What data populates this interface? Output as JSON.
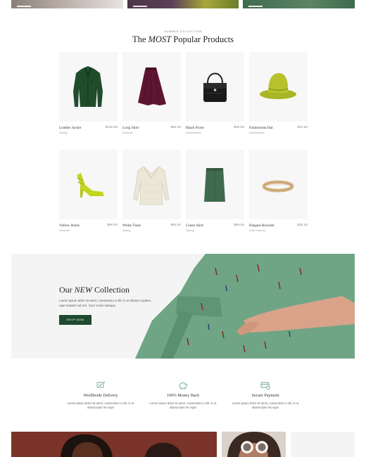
{
  "section": {
    "eyebrow": "Summer Collection",
    "title_prefix": "The ",
    "title_emphasis": "MOST",
    "title_suffix": " Popular Products"
  },
  "products": [
    {
      "name": "Leather Jacket",
      "price": "$150.00",
      "category": "Spring",
      "icon": "leather-jacket"
    },
    {
      "name": "Long Skirt",
      "price": "$80.00",
      "category": "Summer",
      "icon": "long-skirt"
    },
    {
      "name": "Black Purse",
      "price": "$90.00",
      "category": "Accessories",
      "icon": "black-purse"
    },
    {
      "name": "Fashionista Hat",
      "price": "$40.00",
      "category": "Accessories",
      "icon": "green-hat"
    },
    {
      "name": "Yellow Heels",
      "price": "$90.00",
      "category": "Summer",
      "icon": "yellow-heels"
    },
    {
      "name": "White Tunic",
      "price": "$90.00",
      "category": "Spring",
      "icon": "white-sweater"
    },
    {
      "name": "Green Skirt",
      "price": "$90.00",
      "category": "Spring",
      "icon": "green-skirt"
    },
    {
      "name": "Elegant Bracelet",
      "price": "$30.00",
      "category": "Gold Jewelry",
      "icon": "gold-bracelet"
    }
  ],
  "banner": {
    "title_prefix": "Our ",
    "title_emphasis": "NEW",
    "title_suffix": " Collection",
    "text": "Lorem ipsum dolor sit amet, consectetur a elit. In ut ullamco spiiere, eget massim od orci. Cum sociis natoque",
    "button_label": "Shop Now"
  },
  "features": [
    {
      "title": "Worldwide Delivery",
      "text": "Lorem ipsum dolor sit amet, consectetur a elit. In ut ullamcorper leo eget",
      "icon": "delivery-icon"
    },
    {
      "title": "100% Money Back",
      "text": "Lorem ipsum dolor sit amet, consectetur a elit. In ut ullamcorper leo eget",
      "icon": "piggy-bank-icon"
    },
    {
      "title": "Secure Payment",
      "text": "Lorem ipsum dolor sit amet, consectetur a elit. In ut ullamcorper leo eget",
      "icon": "secure-card-icon"
    }
  ],
  "colors": {
    "accent_green": "#1e4a2f",
    "icon_teal": "#6aa59a",
    "banner_dress": "#6fa585"
  }
}
